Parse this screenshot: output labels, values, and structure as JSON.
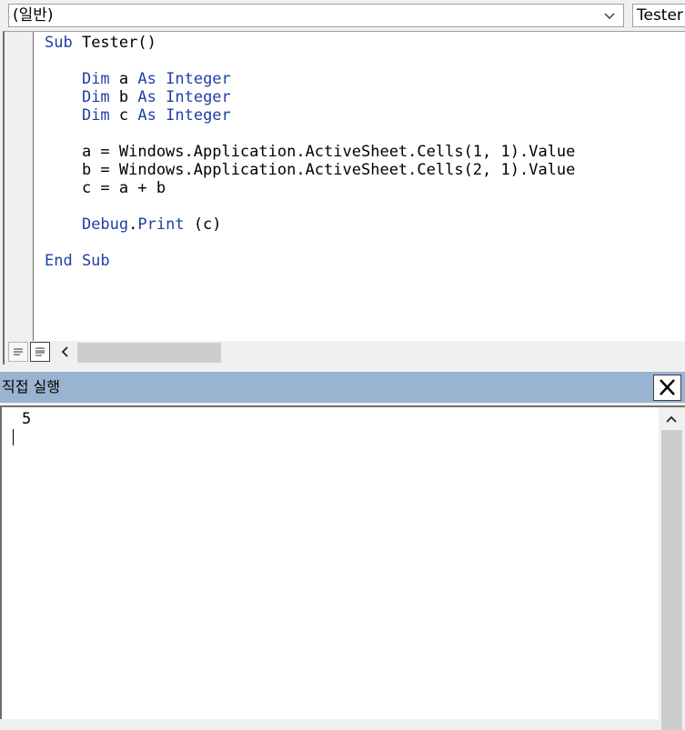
{
  "combo": {
    "object_value": "(일반)",
    "procedure_value": "Tester"
  },
  "code": {
    "lines": [
      [
        {
          "t": "Sub",
          "k": true
        },
        {
          "t": " Tester()",
          "k": false
        }
      ],
      [],
      [
        {
          "t": "    ",
          "k": false
        },
        {
          "t": "Dim",
          "k": true
        },
        {
          "t": " a ",
          "k": false
        },
        {
          "t": "As",
          "k": true
        },
        {
          "t": " ",
          "k": false
        },
        {
          "t": "Integer",
          "k": true
        }
      ],
      [
        {
          "t": "    ",
          "k": false
        },
        {
          "t": "Dim",
          "k": true
        },
        {
          "t": " b ",
          "k": false
        },
        {
          "t": "As",
          "k": true
        },
        {
          "t": " ",
          "k": false
        },
        {
          "t": "Integer",
          "k": true
        }
      ],
      [
        {
          "t": "    ",
          "k": false
        },
        {
          "t": "Dim",
          "k": true
        },
        {
          "t": " c ",
          "k": false
        },
        {
          "t": "As",
          "k": true
        },
        {
          "t": " ",
          "k": false
        },
        {
          "t": "Integer",
          "k": true
        }
      ],
      [],
      [
        {
          "t": "    a = Windows.Application.ActiveSheet.Cells(1, 1).Value",
          "k": false
        }
      ],
      [
        {
          "t": "    b = Windows.Application.ActiveSheet.Cells(2, 1).Value",
          "k": false
        }
      ],
      [
        {
          "t": "    c = a + b",
          "k": false
        }
      ],
      [],
      [
        {
          "t": "    ",
          "k": false
        },
        {
          "t": "Debug",
          "k": true
        },
        {
          "t": ".",
          "k": false
        },
        {
          "t": "Print",
          "k": true
        },
        {
          "t": " (c)",
          "k": false
        }
      ],
      [],
      [
        {
          "t": "End Sub",
          "k": true
        }
      ]
    ]
  },
  "immediate": {
    "title": "직접 실행",
    "output": "5"
  },
  "colors": {
    "keyword": "#1f3fa8",
    "title_bar": "#99b4d1"
  },
  "icons": {
    "object_dropdown": "chevron-down-icon",
    "procedure_view": "procedure-view-icon",
    "full_module_view": "full-module-view-icon",
    "scroll_left": "chevron-left-icon",
    "close": "close-icon",
    "scroll_up": "chevron-up-icon"
  }
}
